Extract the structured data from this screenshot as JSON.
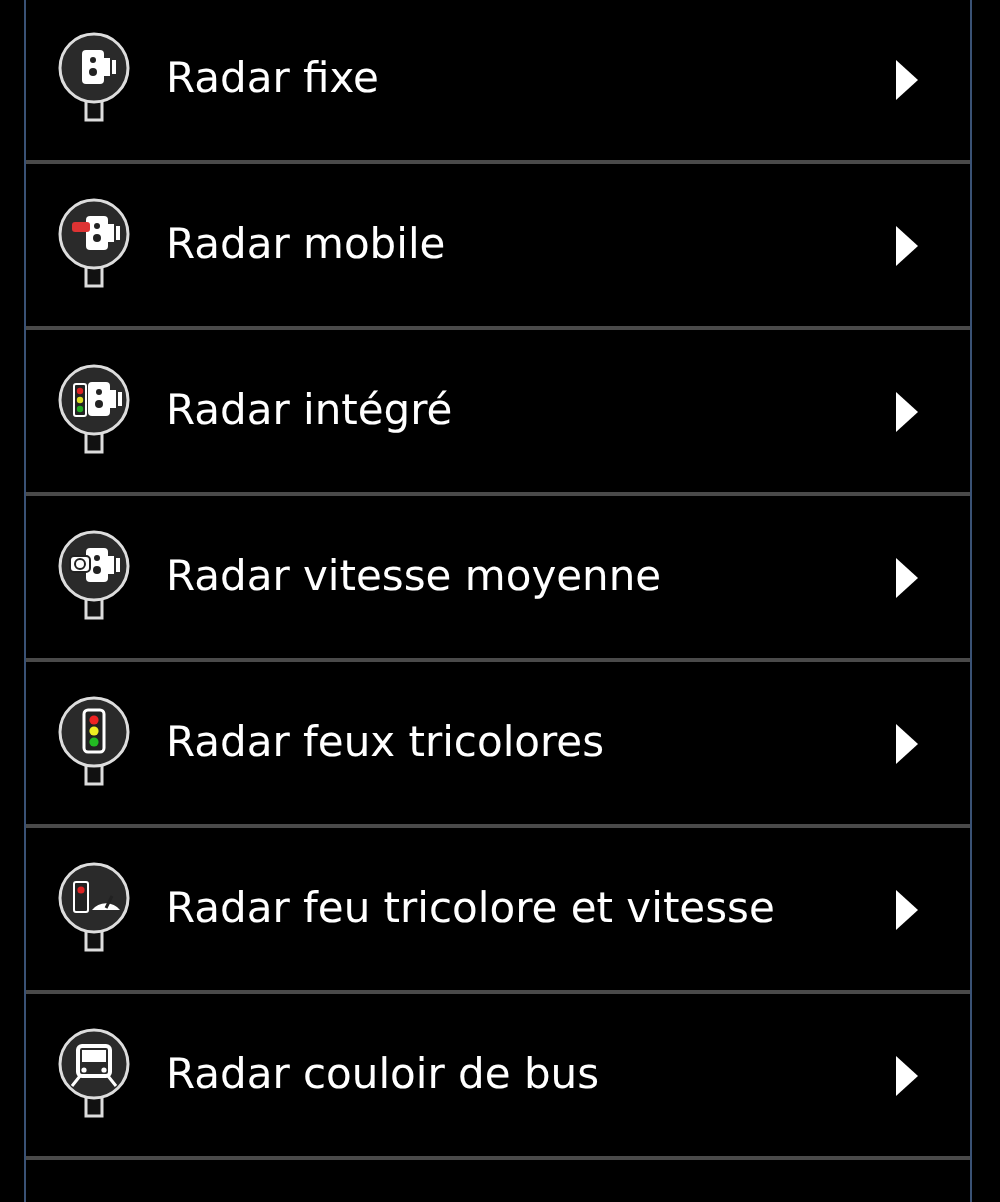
{
  "items": [
    {
      "label": "Radar fixe",
      "kind": "fixed"
    },
    {
      "label": "Radar mobile",
      "kind": "mobile"
    },
    {
      "label": "Radar intégré",
      "kind": "integrated"
    },
    {
      "label": "Radar vitesse moyenne",
      "kind": "average"
    },
    {
      "label": "Radar feux tricolores",
      "kind": "lights"
    },
    {
      "label": "Radar feu tricolore et vitesse",
      "kind": "lightspeed"
    },
    {
      "label": "Radar couloir de bus",
      "kind": "bus"
    }
  ]
}
